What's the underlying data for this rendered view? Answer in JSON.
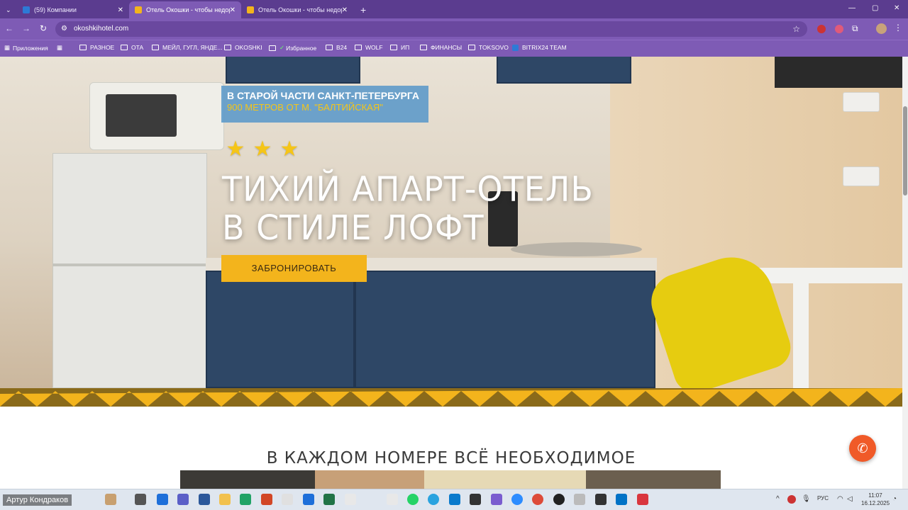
{
  "browser": {
    "tabs": [
      {
        "label": "(59) Компании",
        "active": false
      },
      {
        "label": "Отель Окошки - чтобы недорого",
        "active": true
      },
      {
        "label": "Отель Окошки - чтобы недорого",
        "active": false
      }
    ],
    "new_tab": "+",
    "url": "okoshkihotel.com",
    "window_controls": [
      "—",
      "▢",
      "✕"
    ],
    "bookmarks": [
      {
        "label": "Приложения",
        "type": "apps"
      },
      {
        "label": "РАЗНОЕ",
        "type": "folder"
      },
      {
        "label": "ОТА",
        "type": "folder"
      },
      {
        "label": "МЕЙЛ, ГУГЛ, ЯНДЕ...",
        "type": "folder"
      },
      {
        "label": "OKOSHKI",
        "type": "folder"
      },
      {
        "label": "Избранное",
        "type": "folder"
      },
      {
        "label": "B24",
        "type": "folder"
      },
      {
        "label": "WOLF",
        "type": "folder"
      },
      {
        "label": "ИП",
        "type": "folder"
      },
      {
        "label": "ФИНАНСЫ",
        "type": "folder"
      },
      {
        "label": "TOKSOVO",
        "type": "folder"
      },
      {
        "label": "BITRIX24 TEAM",
        "type": "link"
      }
    ]
  },
  "hero": {
    "location_line1": "В СТАРОЙ ЧАСТИ САНКТ-ПЕТЕРБУРГА",
    "location_line2": "900 МЕТРОВ ОТ М. \"БАЛТИЙСКАЯ\"",
    "stars": 3,
    "title_line1": "ТИХИЙ АПАРТ-ОТЕЛЬ",
    "title_line2": "В СТИЛЕ ЛОФТ",
    "book_button": "ЗАБРОНИРОВАТЬ"
  },
  "section": {
    "title": "В КАЖДОМ НОМЕРЕ ВСЁ НЕОБХОДИМОЕ"
  },
  "colors": {
    "accent_yellow": "#f3b41c",
    "zigzag_dark": "#8a6a1a",
    "call_button": "#f05a28",
    "location_box": "#5094c8",
    "browser_purple": "#7e5bb5"
  },
  "taskbar": {
    "user": "Артур Кондраков",
    "language": "РУС",
    "time": "11:07",
    "date": "16.12.2025"
  }
}
